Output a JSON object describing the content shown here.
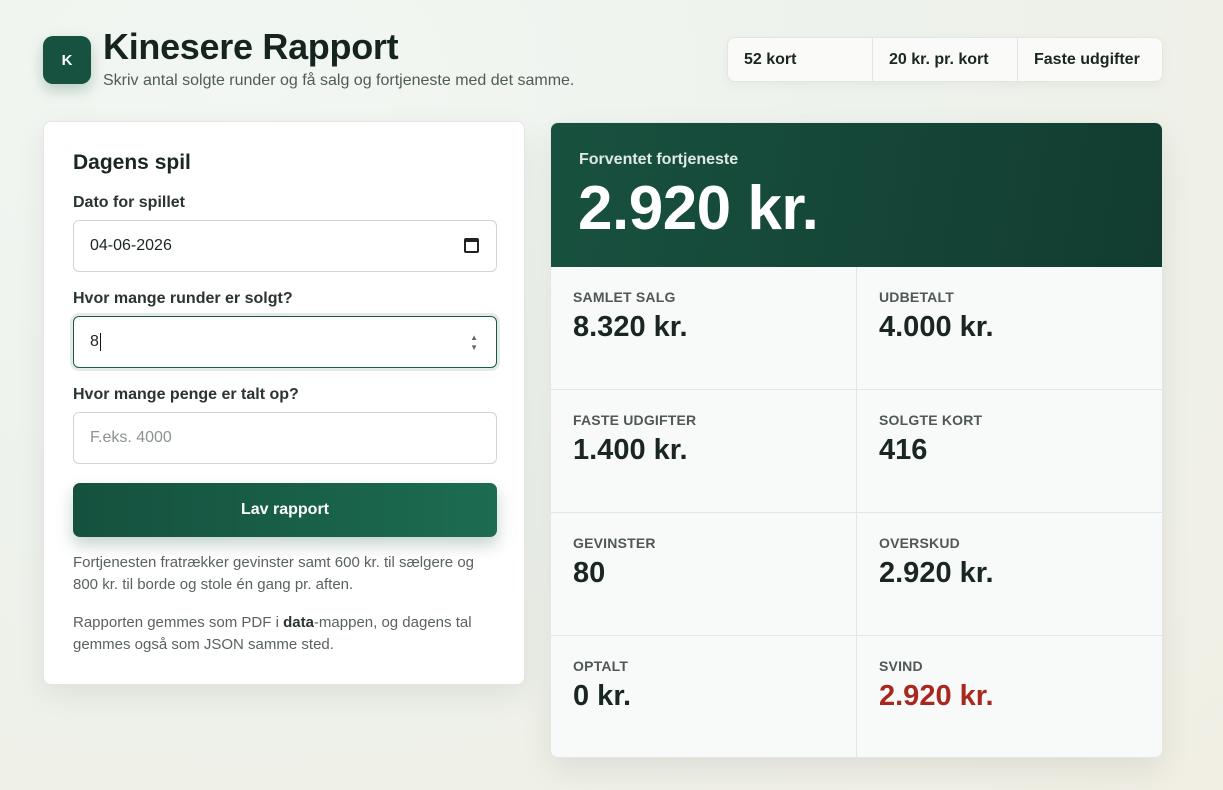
{
  "header": {
    "logo_letter": "K",
    "title": "Kinesere Rapport",
    "subtitle": "Skriv antal solgte runder og få salg og fortjeneste med det samme."
  },
  "chips": [
    "52 kort",
    "20 kr. pr. kort",
    "Faste udgifter"
  ],
  "form": {
    "title": "Dagens spil",
    "date_label": "Dato for spillet",
    "date_value": "04-06-2026",
    "rounds_label": "Hvor mange runder er solgt?",
    "rounds_value": "8",
    "money_label": "Hvor mange penge er talt op?",
    "money_placeholder": "F.eks. 4000",
    "submit_label": "Lav rapport",
    "note1": "Fortjenesten fratrækker gevinster samt 600 kr. til sælgere og 800 kr. til borde og stole én gang pr. aften.",
    "note2_pre": "Rapporten gemmes som PDF i ",
    "note2_bold": "data",
    "note2_post": "-mappen, og dagens tal gemmes også som JSON samme sted."
  },
  "result": {
    "hero_label": "Forventet fortjeneste",
    "hero_value": "2.920 kr.",
    "stats": [
      {
        "label": "SAMLET SALG",
        "value": "8.320 kr."
      },
      {
        "label": "UDBETALT",
        "value": "4.000 kr."
      },
      {
        "label": "FASTE UDGIFTER",
        "value": "1.400 kr."
      },
      {
        "label": "SOLGTE KORT",
        "value": "416"
      },
      {
        "label": "GEVINSTER",
        "value": "80"
      },
      {
        "label": "OVERSKUD",
        "value": "2.920 kr."
      },
      {
        "label": "OPTALT",
        "value": "0 kr."
      },
      {
        "label": "SVIND",
        "value": "2.920 kr."
      }
    ]
  },
  "colors": {
    "brand": "#17513f",
    "loss": "#a8281f"
  }
}
